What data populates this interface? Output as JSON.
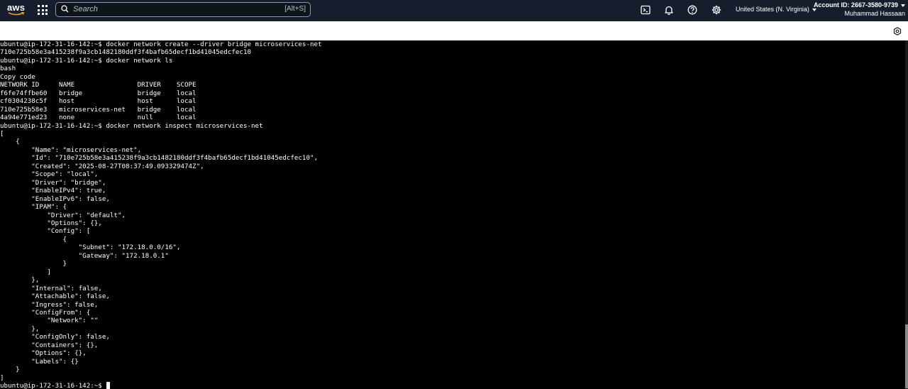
{
  "nav": {
    "logo_text": "aws",
    "search": {
      "placeholder": "Search",
      "shortcut": "[Alt+S]"
    },
    "icons": [
      "services-grid-icon",
      "cloudshell-icon",
      "bell-icon",
      "help-icon",
      "gear-icon"
    ],
    "region": "United States (N. Virginia)",
    "account_id": "Account ID: 2667-3580-9739",
    "account_name": "Muhammad Hassaan"
  },
  "terminal": {
    "lines": [
      "ubuntu@ip-172-31-16-142:~$ docker network create --driver bridge microservices-net",
      "710e725b58e3a415238f9a3cb1482180ddf3f4bafb65decf1bd41045edcfec10",
      "ubuntu@ip-172-31-16-142:~$ docker network ls",
      "bash",
      "Copy code",
      "NETWORK ID     NAME                DRIVER    SCOPE",
      "f6fe74ffbe60   bridge              bridge    local",
      "cf0304238c5f   host                host      local",
      "710e725b58e3   microservices-net   bridge    local",
      "4a94e771ed23   none                null      local",
      "ubuntu@ip-172-31-16-142:~$ docker network inspect microservices-net",
      "[",
      "    {",
      "        \"Name\": \"microservices-net\",",
      "        \"Id\": \"710e725b58e3a415238f9a3cb1482180ddf3f4bafb65decf1bd41045edcfec10\",",
      "        \"Created\": \"2025-08-27T08:37:49.093329474Z\",",
      "        \"Scope\": \"local\",",
      "        \"Driver\": \"bridge\",",
      "        \"EnableIPv4\": true,",
      "        \"EnableIPv6\": false,",
      "        \"IPAM\": {",
      "            \"Driver\": \"default\",",
      "            \"Options\": {},",
      "            \"Config\": [",
      "                {",
      "                    \"Subnet\": \"172.18.0.0/16\",",
      "                    \"Gateway\": \"172.18.0.1\"",
      "                }",
      "            ]",
      "        },",
      "        \"Internal\": false,",
      "        \"Attachable\": false,",
      "        \"Ingress\": false,",
      "        \"ConfigFrom\": {",
      "            \"Network\": \"\"",
      "        },",
      "        \"ConfigOnly\": false,",
      "        \"Containers\": {},",
      "        \"Options\": {},",
      "        \"Labels\": {}",
      "    }",
      "]"
    ],
    "prompt": "ubuntu@ip-172-31-16-142:~$ "
  }
}
